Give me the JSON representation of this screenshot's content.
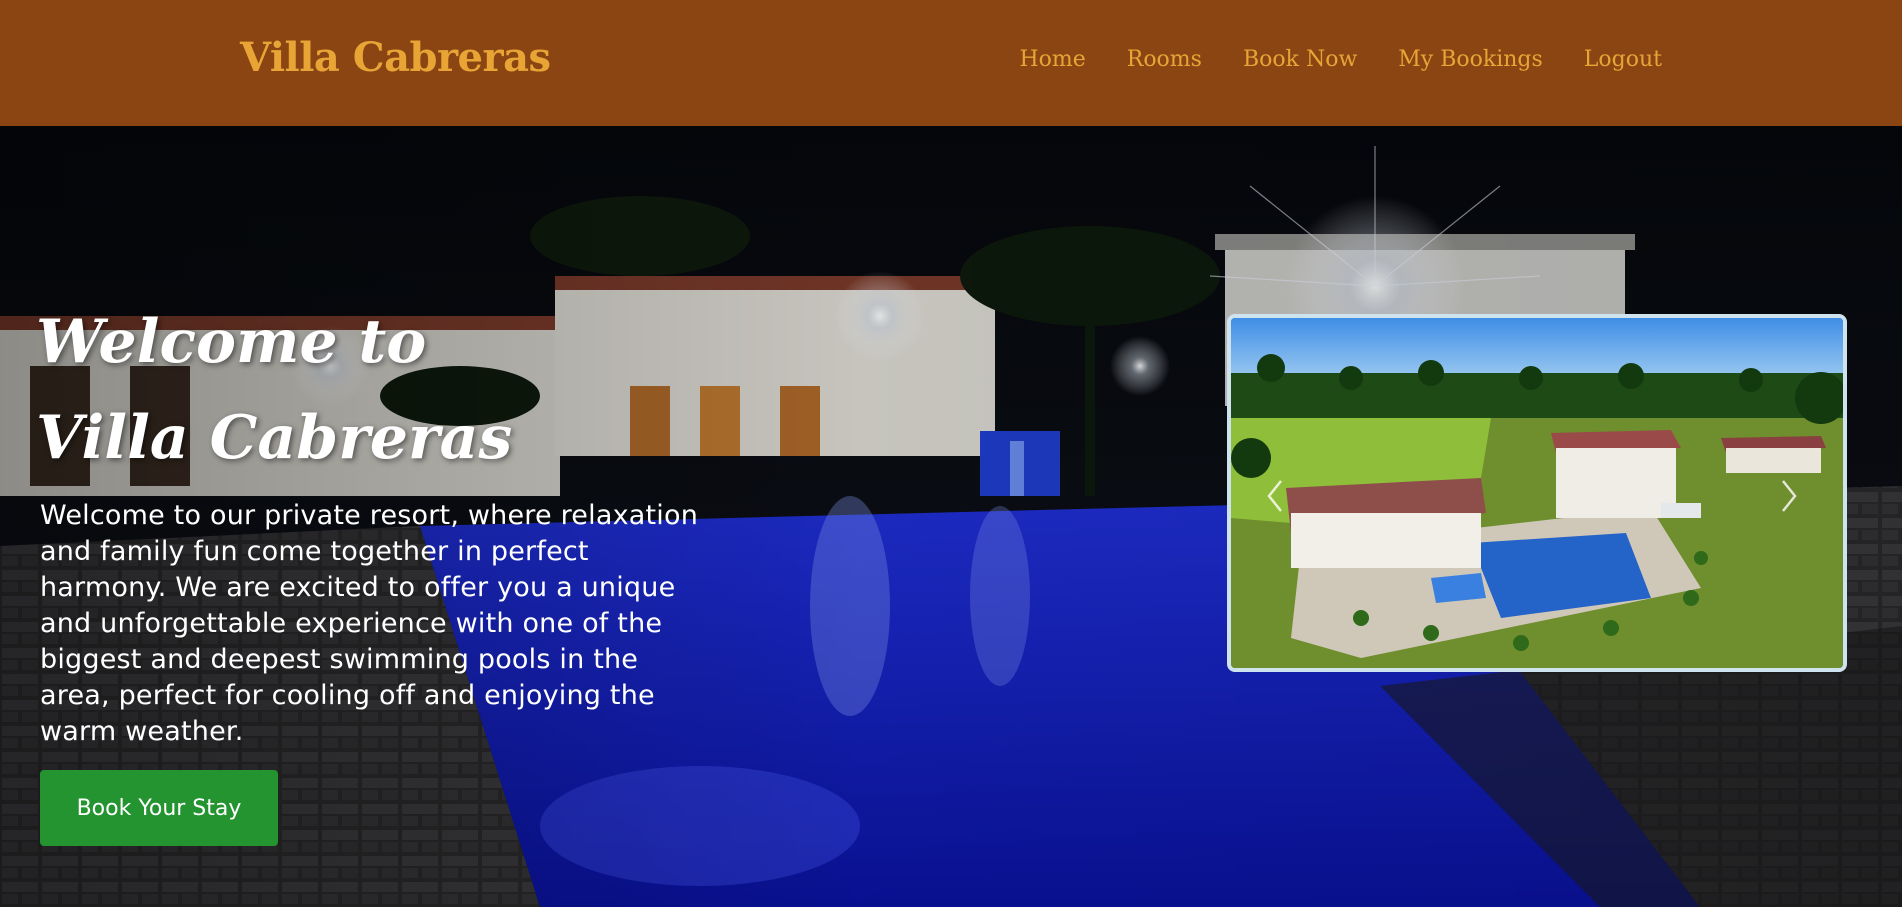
{
  "navbar": {
    "brand": "Villa Cabreras",
    "links": [
      "Home",
      "Rooms",
      "Book Now",
      "My Bookings",
      "Logout"
    ]
  },
  "hero": {
    "title": "Welcome to Villa Cabreras",
    "description": "Welcome to our private resort, where relaxation and family fun come together in perfect harmony. We are excited to offer you a unique and unforgettable experience with one of the biggest and deepest swimming pools in the area, perfect for cooling off and enjoying the warm weather.",
    "cta_label": "Book Your Stay"
  },
  "carousel": {
    "prev_icon": "chevron-left-icon",
    "next_icon": "chevron-right-icon"
  },
  "colors": {
    "navbar_bg": "#8b4513",
    "brand_accent": "#e8a536",
    "cta_bg": "#23942f",
    "carousel_border": "#cfe3ef"
  }
}
